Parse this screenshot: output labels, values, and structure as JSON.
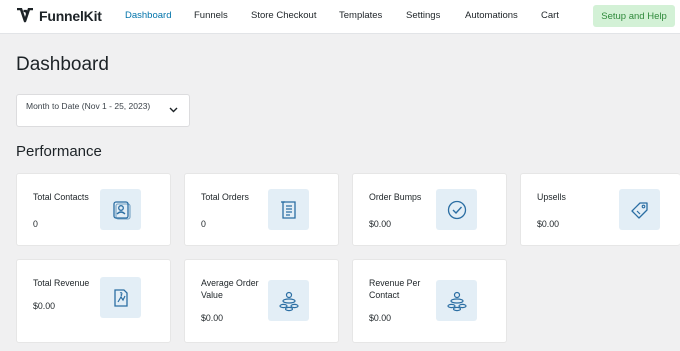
{
  "brand": {
    "name": "FunnelKit"
  },
  "nav": {
    "items": [
      {
        "label": "Dashboard",
        "active": true
      },
      {
        "label": "Funnels",
        "active": false
      },
      {
        "label": "Store Checkout",
        "active": false
      },
      {
        "label": "Templates",
        "active": false
      },
      {
        "label": "Settings",
        "active": false
      },
      {
        "label": "Automations",
        "active": false
      },
      {
        "label": "Cart",
        "active": false
      }
    ],
    "help_button": "Setup and Help"
  },
  "page": {
    "title": "Dashboard",
    "date_range": "Month to Date (Nov 1 - 25, 2023)",
    "section_title": "Performance"
  },
  "cards": [
    {
      "label": "Total Contacts",
      "value": "0",
      "icon": "contacts-icon"
    },
    {
      "label": "Total Orders",
      "value": "0",
      "icon": "orders-icon"
    },
    {
      "label": "Order Bumps",
      "value": "$0.00",
      "icon": "check-circle-icon"
    },
    {
      "label": "Upsells",
      "value": "$0.00",
      "icon": "tag-icon"
    },
    {
      "label": "Total Revenue",
      "value": "$0.00",
      "icon": "revenue-icon"
    },
    {
      "label": "Average Order Value",
      "value": "$0.00",
      "icon": "coins-icon"
    },
    {
      "label": "Revenue Per Contact",
      "value": "$0.00",
      "icon": "coins-icon"
    }
  ],
  "colors": {
    "accent": "#0073aa",
    "help_bg": "#d3f1d6",
    "help_text": "#2f8a3b",
    "icon_bg": "#e3eef6",
    "icon_stroke": "#2b6ea3"
  }
}
